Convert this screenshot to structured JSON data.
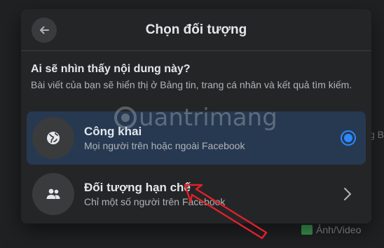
{
  "modal": {
    "title": "Chọn đối tượng",
    "back_icon": "arrow-left-icon"
  },
  "intro": {
    "title": "Ai sẽ nhìn thấy nội dung này?",
    "description": "Bài viết của bạn sẽ hiển thị ở Bảng tin, trang cá nhân và kết quả tìm kiếm."
  },
  "options": [
    {
      "label": "Công khai",
      "description": "Mọi người trên hoặc ngoài Facebook",
      "icon": "globe-icon",
      "selected": true
    },
    {
      "label": "Đối tượng hạn chế",
      "description": "Chỉ một số người trên Facebook",
      "icon": "people-icon",
      "selected": false
    }
  ],
  "background": {
    "photo_label": "Ảnh/Video",
    "right_fragment": "g B"
  },
  "watermark": {
    "text": "uantrimang"
  },
  "colors": {
    "modal_bg": "#242526",
    "selected_bg": "#263951",
    "accent": "#2d88ff",
    "annotation_arrow": "#e0202a"
  }
}
